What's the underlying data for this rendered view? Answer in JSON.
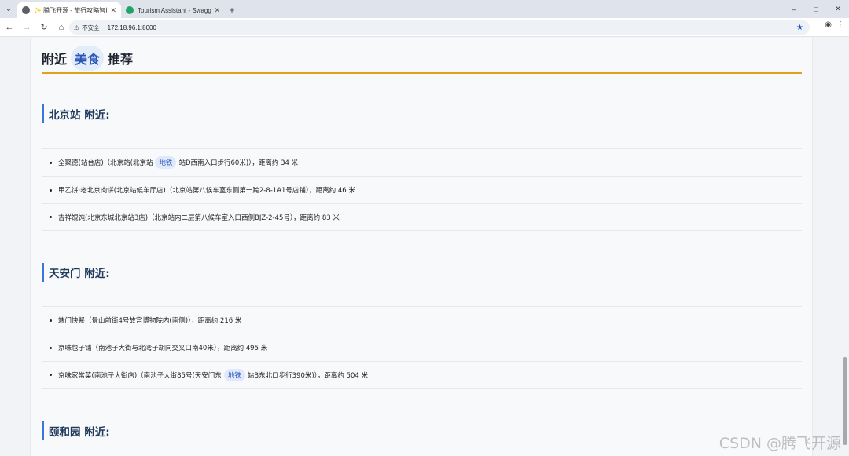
{
  "browser": {
    "tabs": [
      {
        "label": "✨ 腾飞开源 - 旅行攻略智能助手",
        "active": true,
        "favicon_color": "#5a5f6a"
      },
      {
        "label": "Tourism Assistant - Swagger",
        "active": false,
        "favicon_color": "#21a366"
      }
    ],
    "new_tab": "+",
    "window_controls": [
      "–",
      "□",
      "✕"
    ],
    "address": {
      "security_label": "不安全",
      "url": "172.18.96.1:8000"
    }
  },
  "page": {
    "section_title": {
      "prefix": "附近",
      "highlight": "美食",
      "suffix": "推荐"
    },
    "areas": [
      {
        "name": "北京站 附近:",
        "items": [
          {
            "before": "全聚德(站台店)（北京站(北京站",
            "tag": "地铁",
            "after": "站D西南入口步行60米)），距离约 34 米"
          },
          {
            "before": "甲乙饼·老北京肉饼(北京站候车厅店)（北京站第八候车室东侧第一跨2-8-1A1号店铺），距离约 46 米",
            "tag": "",
            "after": ""
          },
          {
            "before": "吉祥馄饨(北京东城北京站3店)（北京站内二层第八候车室入口西侧BJZ-2-45号），距离约 83 米",
            "tag": "",
            "after": ""
          }
        ]
      },
      {
        "name": "天安门 附近:",
        "items": [
          {
            "before": "端门快餐（景山前街4号故宫博物院内(南侧)），距离约 216 米",
            "tag": "",
            "after": ""
          },
          {
            "before": "京味包子铺（南池子大街与北湾子胡同交叉口南40米），距离约 495 米",
            "tag": "",
            "after": ""
          },
          {
            "before": "京味家常菜(南池子大街店)（南池子大街85号(天安门东",
            "tag": "地铁",
            "after": "站B东北口步行390米)），距离约 504 米"
          }
        ]
      },
      {
        "name": "颐和园 附近:",
        "items": []
      }
    ]
  },
  "watermark": "CSDN @腾飞开源"
}
